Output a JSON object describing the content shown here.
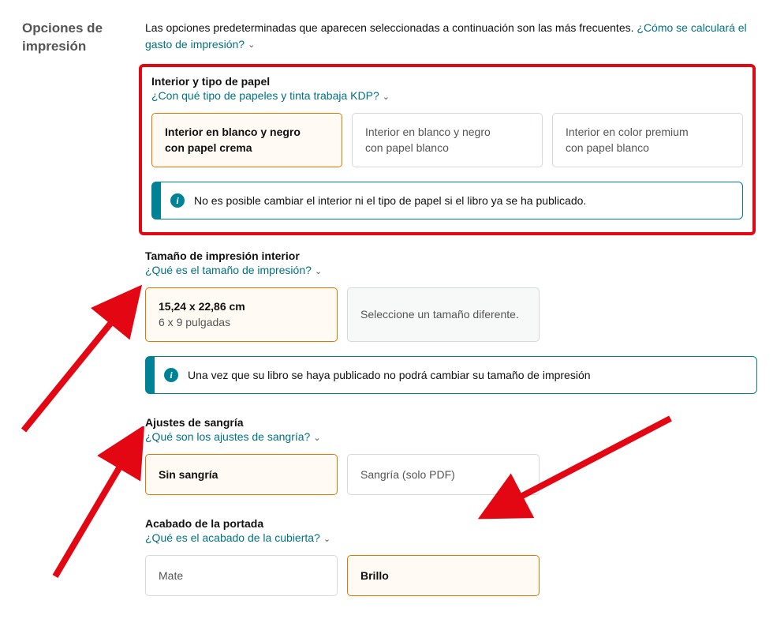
{
  "sidebar": {
    "title_l1": "Opciones de",
    "title_l2": "impresión"
  },
  "intro": {
    "text": "Las opciones predeterminadas que aparecen seleccionadas a continuación son las más frecuentes. ",
    "link": "¿Cómo se calculará el gasto de impresión?"
  },
  "sections": {
    "interior": {
      "title": "Interior y tipo de papel",
      "help": "¿Con qué tipo de papeles y tinta trabaja KDP?",
      "options": [
        {
          "l1": "Interior en blanco y negro",
          "l2": "con papel crema"
        },
        {
          "l1": "Interior en blanco y negro",
          "l2": "con papel blanco"
        },
        {
          "l1": "Interior en color premium",
          "l2": "con papel blanco"
        }
      ],
      "info": "No es posible cambiar el interior ni el tipo de papel si el libro ya se ha publicado."
    },
    "trim": {
      "title": "Tamaño de impresión interior",
      "help": "¿Qué es el tamaño de impresión?",
      "options": [
        {
          "l1": "15,24 x 22,86 cm",
          "l2": "6 x 9 pulgadas"
        },
        {
          "l1": "Seleccione un tamaño diferente."
        }
      ],
      "info": "Una vez que su libro se haya publicado no podrá cambiar su tamaño de impresión"
    },
    "bleed": {
      "title": "Ajustes de sangría",
      "help": "¿Qué son los ajustes de sangría?",
      "options": [
        {
          "l1": "Sin sangría"
        },
        {
          "l1": "Sangría (solo PDF)"
        }
      ]
    },
    "cover": {
      "title": "Acabado de la portada",
      "help": "¿Qué es el acabado de la cubierta?",
      "options": [
        {
          "l1": "Mate"
        },
        {
          "l1": "Brillo"
        }
      ]
    }
  }
}
